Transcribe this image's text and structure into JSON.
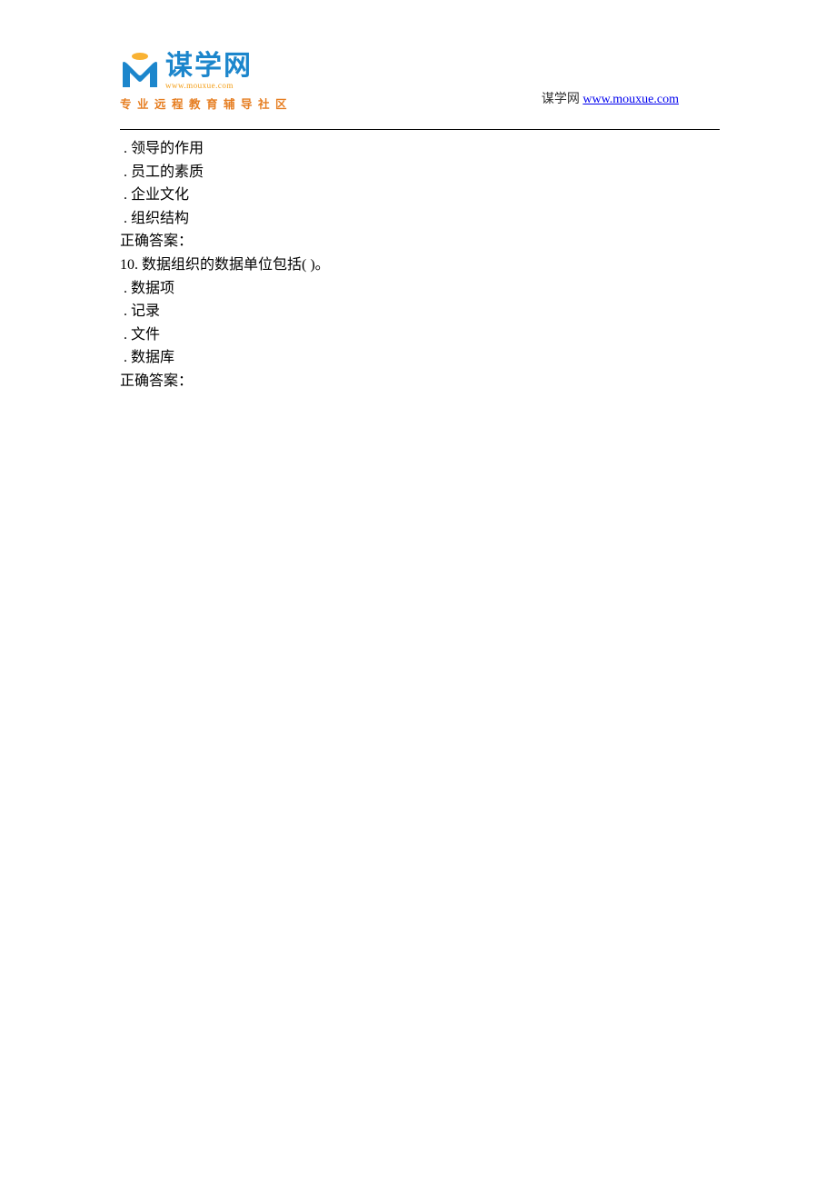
{
  "header": {
    "logo_main": "谋学网",
    "logo_sub": "www.mouxue.com",
    "logo_tagline": "专业远程教育辅导社区",
    "right_text": "谋学网 ",
    "right_link": "www.mouxue.com"
  },
  "content": {
    "lines": [
      {
        "type": "option",
        "text": ".  领导的作用"
      },
      {
        "type": "option",
        "text": ".  员工的素质"
      },
      {
        "type": "option",
        "text": ".  企业文化"
      },
      {
        "type": "option",
        "text": ".  组织结构"
      },
      {
        "type": "answer",
        "text": "正确答案："
      },
      {
        "type": "question",
        "text": "10.   数据组织的数据单位包括( )。"
      },
      {
        "type": "option",
        "text": ".  数据项"
      },
      {
        "type": "option",
        "text": ".  记录"
      },
      {
        "type": "option",
        "text": ".  文件"
      },
      {
        "type": "option",
        "text": ".  数据库"
      },
      {
        "type": "answer",
        "text": "正确答案："
      }
    ]
  }
}
